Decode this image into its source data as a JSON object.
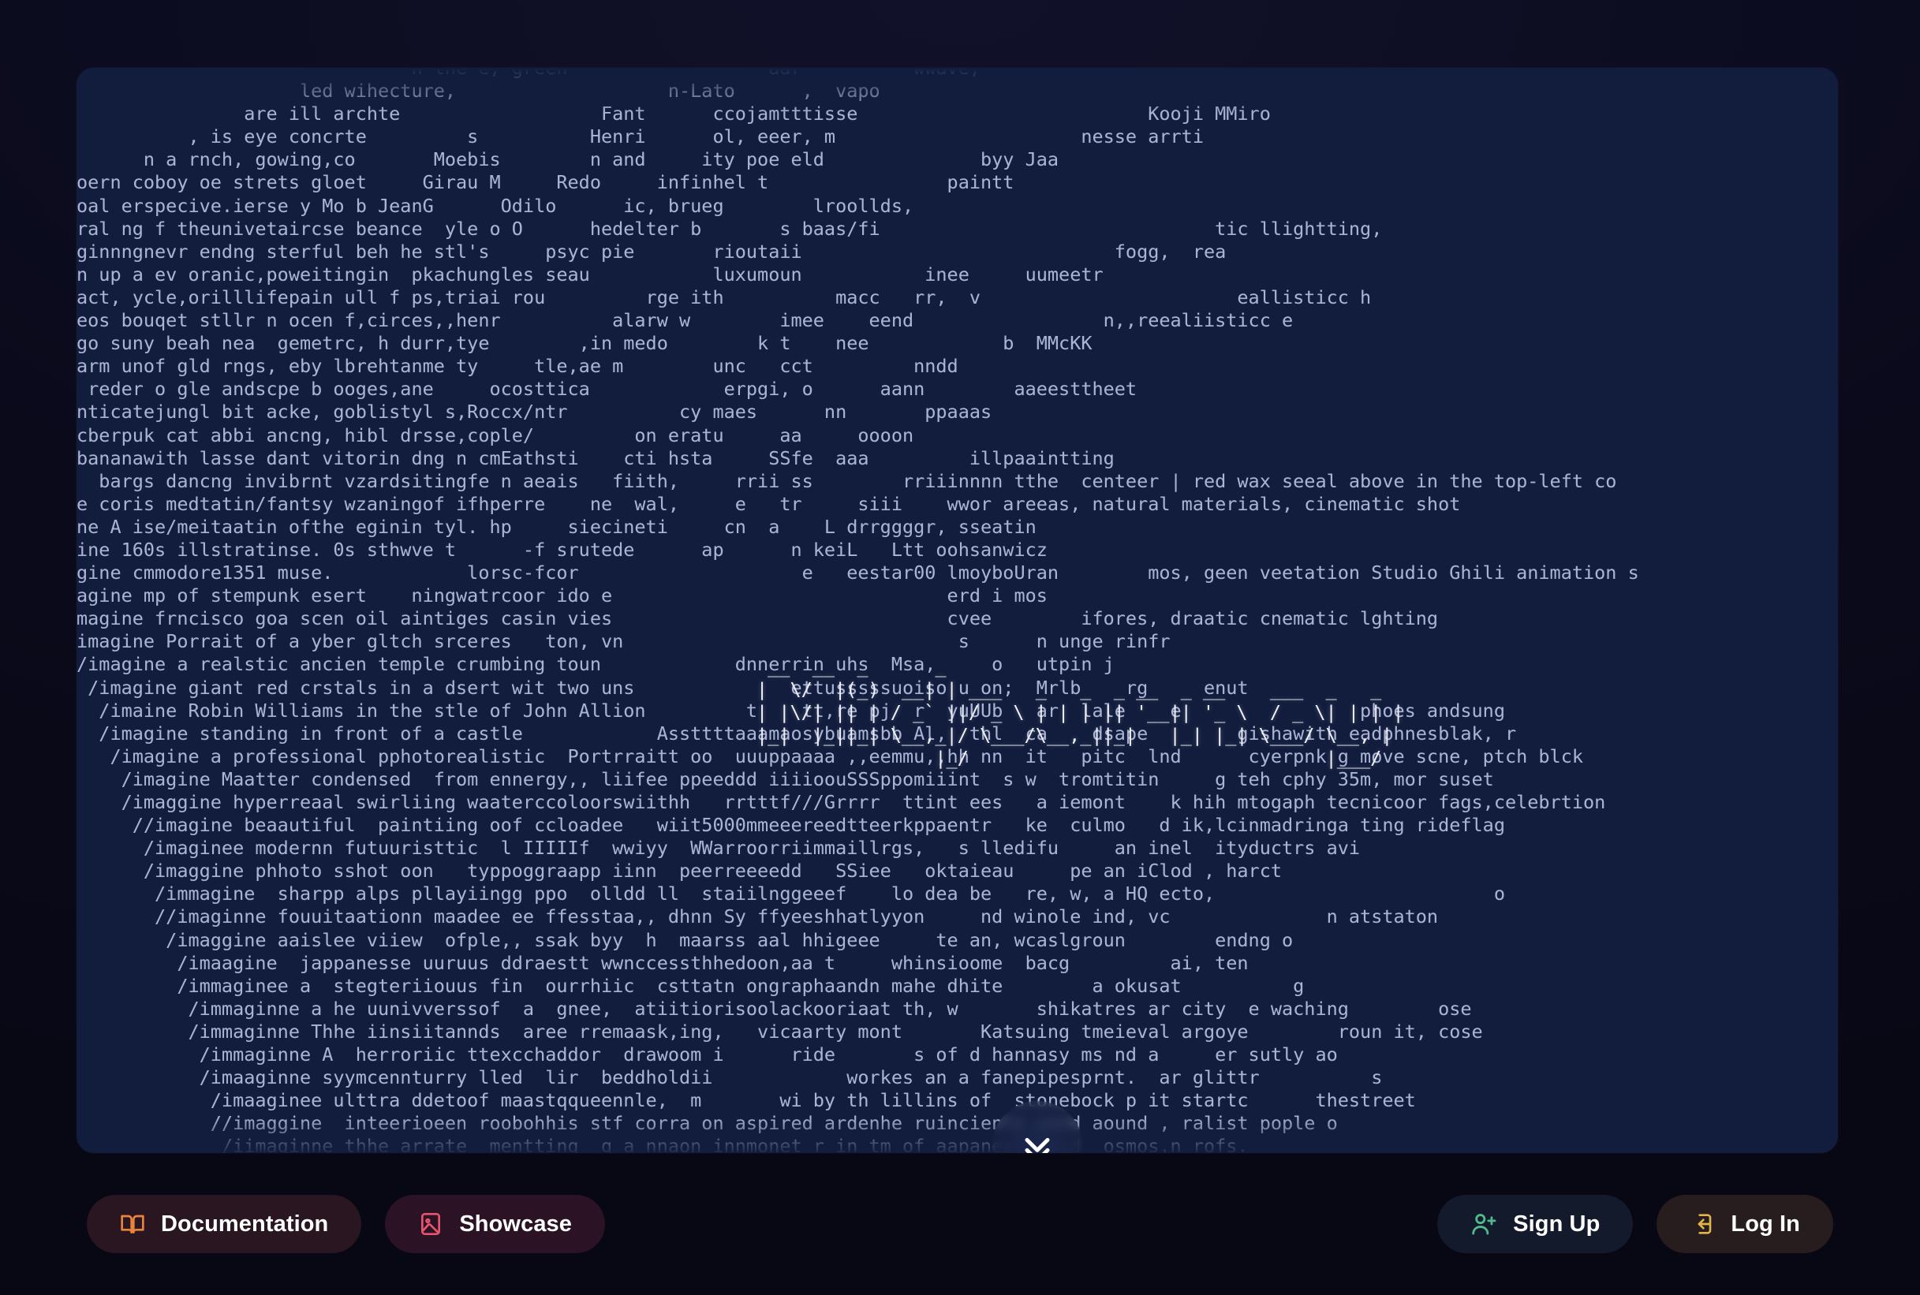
{
  "page": {
    "background_color": "#0a0a1b",
    "panel_color": "#121c3c",
    "text_color": "#aab3d4"
  },
  "terminal": {
    "name": "ascii-prompt-rain",
    "font": "monospace",
    "lines": [
      "                              n the e, green                  aar          wwave,",
      "                    led wihecture,                   n-Lato      ,  vapo",
      "               are ill archte                  Fant      ccojamtttisse                          Kooji MMiro",
      "          , is eye concrte         s          Henri      ol, eeer, m                      nesse arrti",
      "      n a rnch, gowing,co       Moebis        n and     ity poe eld              byy Jaa",
      "oern coboy oe strets gloet     Girau M     Redo     infinhel t                paintt",
      "oal erspecive.ierse y Mo b JeanG      Odilo      ic, brueg        lroollds,",
      "ral ng f theunivetaircse beance  yle o O      hedelter b       s baas/fi                              tic llightting,",
      "ginnngnevr endng sterful beh he stl's     psyc pie       rioutaii                            fogg,  rea",
      "n up a ev oranic,poweitingin  pkachungles seau           luxumoun           inee     uumeetr",
      "act, ycle,orilllifepain ull f ps,triai rou         rge ith          macc   rr,  v                       eallisticc h",
      "eos bouqet stllr n ocen f,circes,,henr          alarw w        imee    eend                 n,,reealiisticc e",
      "go suny beah nea  gemetrc, h durr,tye        ,in medo        k t    nee            b  MMcKK",
      "arm unof gld rngs, eby lbrehtanme ty     tle,ae m        unc   cct         nndd",
      " reder o gle andscpe b ooges,ane     ocosttica            erpgi, o      aann        aaeesttheet",
      "nticatejungl bit acke, goblistyl s,Roccx/ntr          cy maes      nn       ppaaas",
      "cberpuk cat abbi ancng, hibl drsse,cople/         on eratu     aa     oooon",
      "bananawith lasse dant vitorin dng n cmEathsti    cti hsta     SSfe  aaa         illpaaintting",
      "  bargs dancng invibrnt vzardsitingfe n aeais   fiith,     rrii ss        rriiinnnn tthe  centeer | red wax seeal above in the top-left co",
      "e coris medtatin/fantsy wzaningof ifhperre    ne  wal,     e   tr     siii    wwor areeas, natural materials, cinematic shot",
      "ne A ise/meitaatin ofthe eginin tyl. hp     siecineti     cn  a    L drrggggr, sseatin",
      "ine 160s illstratinse. 0s sthwve t      -f srutede      ap      n keiL   Ltt oohsanwicz",
      "gine cmmodore1351 muse.            lorsc-fcor                    e   eestar00 lmoyboUran        mos, geen veetation Studio Ghili animation s",
      "agine mp of stempunk esert    ningwatrcoor ido e                              erd i mos",
      "magine frncisco goa scen oil aintiges casin vies                              cvee        ifores, draatic cnematic lghting",
      "imagine Porrait of a yber gltch srceres   ton, vn                              s      n unge rinfr",
      "/imagine a realstic ancien temple crumbing toun            dnnerrin uhs  Msa,     o   utpin j",
      " /imagine giant red crstals in a dsert wit two uns              ettusssssuoiso u on;  Mrlb    rg     enut",
      "  /imaine Robin Williams in the stle of John Allion         t    tt,re pj  r  yuUUb   ar  lale    e                phoes andsung",
      "  /imagine standing in front of a castle            Assttttaaamaosybuamsbb Al,  thl  ca    dsape        gishawith eadphnesblak, r",
      "   /imagine a professional pphotorealistic  Portrraitt oo  uuuppaaaa ,,eemmu,,hh nn  it   pitc  lnd      cyerpnk g move scne, ptch blck",
      "    /imagine Maatter condensed  from ennergy,, liifee ppeeddd iiiioouSSSppomiiint  s w  tromtitin     g teh cphy 35m, mor suset",
      "    /imaggine hyperreaal swirliing waaterccoloorswiithh   rrtttf///Grrrr  ttint ees   a iemont    k hih mtogaph tecnicoor fags,celebrtion",
      "     //imagine beaautiful  paintiing oof ccloadee   wiit5000mmeeereedtteerkppaentr   ke  culmo   d ik,lcinmadringa ting rideflag",
      "      /imaginee modernn futuuristtic  l IIIIIf  wwiyy  WWarroorriimmaillrgs,   s lledifu     an inel  ityductrs avi",
      "      /imaggine phhoto sshot oon   typpoggraapp iinn  peerreeeedd   SSiee   oktaieau     pe an iClod , harct",
      "       /immagine  sharpp alps pllayiingg ppo  olldd ll  staiilnggeeef    lo dea be   re, w, a HQ ecto,                         o",
      "       //imaginne fouuitaationn maadee ee ffesstaa,, dhnn Sy ffyeeshhatlyyon     nd winole ind, vc              n atstaton",
      "        /imaggine aaislee viiew  ofple,, ssak byy  h  maarss aal hhigeee     te an, wcaslgroun        endng o",
      "         /imaagine  jappanesse uuruus ddraestt wwnccessthhedoon,aa t     whinsioome  bacg         ai, ten",
      "         /immaginee a  stegteriiouus fin  ourrhiic  csttatn ongraphaandn mahe dhite        a okusat          g",
      "          /immaginne a he uunivverssof  a  gnee,  atiitiorisoolackooriaat th, w       shikatres ar city  e waching        ose",
      "          /immaginne Thhe iinsiitannds  aree rremaask,ing,   vicaarty mont       Katsuing tmeieval argoye        roun it, cose",
      "           /immaginne A  herroriic ttexcchaddor  drawoom i      ride       s of d hannasy ms nd a     er sutly ao",
      "           /imaaginne syymcennturry lled  lir  beddholdii            workes an a fanepipesprnt.  ar glittr          s",
      "            /imaaginee ulttra ddetoof maastqqueennle,  m       wi by th lillins of  stonebock p it startc      thestreet",
      "            //imaggine  inteerioeen roobohhis stf corra on aspired ardenhe ruinciente wood aound , ralist pople o",
      "             /iimaginne thhe arrate  mentting  g a nnaon innmonet r in tm of aapanesf void  osmos.n rofs."
    ]
  },
  "ascii_logo": {
    "name": "midjourney-wordmark",
    "lines": [
      " __  __  _      _                                            ",
      "|  \\/  |(_)  __| | ___   _   _  _ __  _ __    ___  _   _   ",
      "| |\\/| || | / _` ||/ _ \\ | | | || '__|| '_ \\  / _ \\| | | | ",
      "|_|  |_||_| \\__,_|/ \\___/\\__,_||_|   |_| |_| \\___/ \\__, | ",
      "                |_/                                |___/    "
    ]
  },
  "scroll_indicator": {
    "name": "scroll-down-chevrons",
    "icon": "double-chevron-down-icon"
  },
  "bottom_bar": {
    "left_buttons": [
      {
        "id": "documentation",
        "label": "Documentation",
        "icon": "book-open-icon",
        "icon_color": "#e8843c",
        "bg": "#2a1620"
      },
      {
        "id": "showcase",
        "label": "Showcase",
        "icon": "image-icon",
        "icon_color": "#e4566e",
        "bg": "#2b1325"
      }
    ],
    "right_buttons": [
      {
        "id": "signup",
        "label": "Sign Up",
        "icon": "user-plus-icon",
        "icon_color": "#4fba8b",
        "bg": "#131a2c"
      },
      {
        "id": "login",
        "label": "Log In",
        "icon": "login-arrow-icon",
        "icon_color": "#e0b64a",
        "bg": "#271c1e"
      }
    ]
  }
}
